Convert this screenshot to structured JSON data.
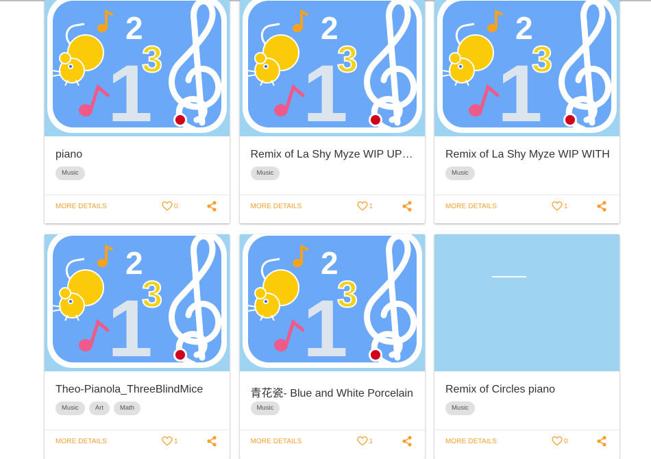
{
  "colors": {
    "accent": "#f7a02f",
    "thumb_bg": "#9ed4f1",
    "icon_panel": "#6ba9f8",
    "mouse": "#fbcb0a",
    "note_pink": "#ee5b8a"
  },
  "actions": {
    "more_details": "MORE DETAILS"
  },
  "icons": {
    "like": "heart-icon",
    "share": "share-icon"
  },
  "cards": [
    {
      "title": "piano",
      "tags": [
        "Music"
      ],
      "likes": "0",
      "thumbnail": "music-app-icon"
    },
    {
      "title": "Remix of La Shy Myze WIP UPDATE",
      "tags": [
        "Music"
      ],
      "likes": "1",
      "thumbnail": "music-app-icon"
    },
    {
      "title": "Remix of La Shy Myze WIP WITH",
      "tags": [
        "Music"
      ],
      "likes": "1",
      "thumbnail": "music-app-icon"
    },
    {
      "title": "Theo-Pianola_ThreeBlindMice",
      "tags": [
        "Music",
        "Art",
        "Math"
      ],
      "likes": "1",
      "thumbnail": "music-app-icon"
    },
    {
      "title": "青花瓷- Blue and White Porcelain",
      "tags": [
        "Music"
      ],
      "likes": "1",
      "thumbnail": "music-app-icon"
    },
    {
      "title": "Remix of Circles piano",
      "tags": [
        "Music"
      ],
      "likes": "0",
      "thumbnail": "loading-placeholder"
    }
  ]
}
